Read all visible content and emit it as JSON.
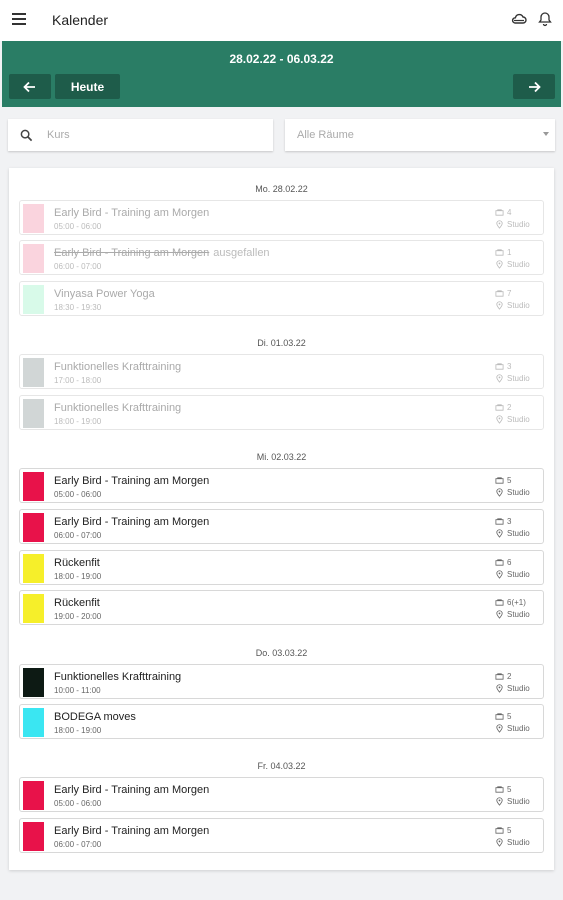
{
  "app": {
    "title": "Kalender",
    "icons": [
      "menu-icon",
      "cloud-icon",
      "bell-icon"
    ]
  },
  "week": {
    "range": "28.02.22 - 06.03.22",
    "today_label": "Heute",
    "prev_icon": "arrow-left-icon",
    "next_icon": "arrow-right-icon"
  },
  "filters": {
    "search_placeholder": "Kurs",
    "room_value": "Alle Räume"
  },
  "colors": {
    "header_bg": "#2a7d65",
    "nav_button_bg": "#1e5c4a",
    "pink": "#f4a0b5",
    "mint": "#a8f5cf",
    "gray": "#9aa3a3",
    "crimson": "#e8124a",
    "yellow": "#f6ef2a",
    "black": "#0d1a14",
    "cyan": "#3ae6f2"
  },
  "days": [
    {
      "label": "Mo. 28.02.22",
      "events": [
        {
          "title": "Early Bird - Training am Morgen",
          "time": "05:00 - 06:00",
          "count": "4",
          "room": "Studio",
          "color": "#f4a0b5",
          "past": true
        },
        {
          "title": "Early Bird - Training am Morgen",
          "tag": "ausgefallen",
          "time": "06:00 - 07:00",
          "count": "1",
          "room": "Studio",
          "color": "#f4a0b5",
          "past": true,
          "cancelled": true
        },
        {
          "title": "Vinyasa Power Yoga",
          "time": "18:30 - 19:30",
          "count": "7",
          "room": "Studio",
          "color": "#a8f5cf",
          "past": true
        }
      ]
    },
    {
      "label": "Di. 01.03.22",
      "events": [
        {
          "title": "Funktionelles Krafttraining",
          "time": "17:00 - 18:00",
          "count": "3",
          "room": "Studio",
          "color": "#9aa3a3",
          "past": true
        },
        {
          "title": "Funktionelles Krafttraining",
          "time": "18:00 - 19:00",
          "count": "2",
          "room": "Studio",
          "color": "#9aa3a3",
          "past": true
        }
      ]
    },
    {
      "label": "Mi. 02.03.22",
      "events": [
        {
          "title": "Early Bird - Training am Morgen",
          "time": "05:00 - 06:00",
          "count": "5",
          "room": "Studio",
          "color": "#e8124a"
        },
        {
          "title": "Early Bird - Training am Morgen",
          "time": "06:00 - 07:00",
          "count": "3",
          "room": "Studio",
          "color": "#e8124a"
        },
        {
          "title": "Rückenfit",
          "time": "18:00 - 19:00",
          "count": "6",
          "room": "Studio",
          "color": "#f6ef2a"
        },
        {
          "title": "Rückenfit",
          "time": "19:00 - 20:00",
          "count": "6(+1)",
          "room": "Studio",
          "color": "#f6ef2a"
        }
      ]
    },
    {
      "label": "Do. 03.03.22",
      "events": [
        {
          "title": "Funktionelles Krafttraining",
          "time": "10:00 - 11:00",
          "count": "2",
          "room": "Studio",
          "color": "#0d1a14"
        },
        {
          "title": "BODEGA moves",
          "time": "18:00 - 19:00",
          "count": "5",
          "room": "Studio",
          "color": "#3ae6f2"
        }
      ]
    },
    {
      "label": "Fr. 04.03.22",
      "events": [
        {
          "title": "Early Bird - Training am Morgen",
          "time": "05:00 - 06:00",
          "count": "5",
          "room": "Studio",
          "color": "#e8124a"
        },
        {
          "title": "Early Bird - Training am Morgen",
          "time": "06:00 - 07:00",
          "count": "5",
          "room": "Studio",
          "color": "#e8124a"
        }
      ]
    }
  ]
}
